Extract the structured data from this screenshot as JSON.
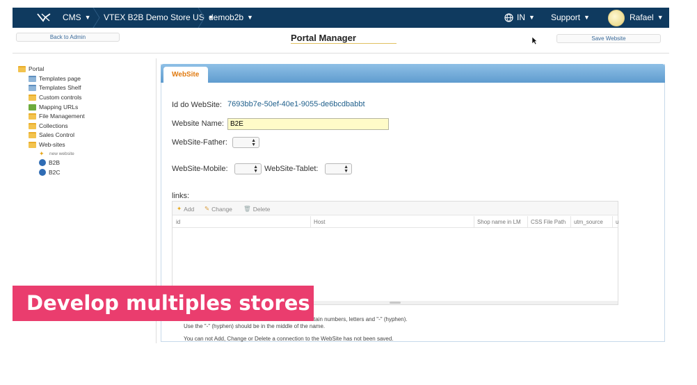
{
  "topbar": {
    "cms_label": "CMS",
    "store_label": "VTEX B2B Demo Store US",
    "account_label": "demob2b",
    "language_label": "IN",
    "support_label": "Support",
    "user_label": "Rafael",
    "background": "#0f3a5f"
  },
  "header": {
    "back_label": "Back to Admin",
    "title": "Portal Manager",
    "save_label": "Save Website"
  },
  "tree": {
    "root": "Portal",
    "items": [
      {
        "label": "Templates page",
        "icon": "template-folder-icon"
      },
      {
        "label": "Templates Shelf",
        "icon": "template-folder-icon"
      },
      {
        "label": "Custom controls",
        "icon": "controls-folder-icon"
      },
      {
        "label": "Mapping URLs",
        "icon": "mapping-arrow-icon"
      },
      {
        "label": "File Management",
        "icon": "folder-icon"
      },
      {
        "label": "Collections",
        "icon": "folder-icon"
      },
      {
        "label": "Sales Control",
        "icon": "folder-icon"
      },
      {
        "label": "Web-sites",
        "icon": "folder-open-icon"
      }
    ],
    "websites": {
      "new_label": "new website",
      "sites": [
        "B2B",
        "B2C"
      ]
    }
  },
  "tab": {
    "label": "WebSite"
  },
  "form": {
    "id_label": "Id do WebSite:",
    "id_value": "7693bb7e-50ef-40e1-9055-de6bcdbabbt",
    "name_label": "Website Name:",
    "name_value": "B2E",
    "father_label": "WebSite-Father:",
    "mobile_label": "WebSite-Mobile:",
    "tablet_label": "WebSite-Tablet:"
  },
  "links": {
    "label": "links:",
    "toolbar": {
      "add": "Add",
      "change": "Change",
      "delete": "Delete"
    },
    "columns": [
      "id",
      "Host",
      "Shop name in LM",
      "CSS File Path",
      "utm_source",
      "u"
    ]
  },
  "notes": {
    "line1": "tain numbers, letters and \"-\" (hyphen).",
    "line2": "Use the \"-\" (hyphen) should be in the middle of the name.",
    "line3": "You can not Add, Change or Delete a connection to the WebSite has not been saved."
  },
  "banner": {
    "text": "Develop multiples stores",
    "color": "#ea3d6e"
  },
  "colors": {
    "accent_orange": "#e07a10",
    "link_blue": "#1f5f8b",
    "tab_blue": "#5f9ccf",
    "input_highlight": "#fffbc8"
  }
}
